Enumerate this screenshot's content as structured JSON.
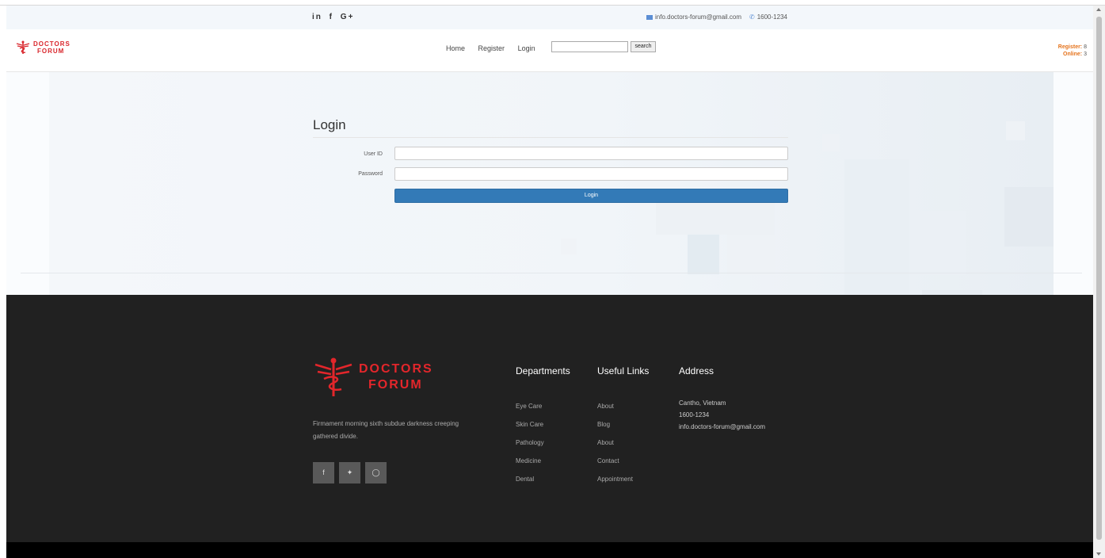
{
  "topbar": {
    "social": [
      "in",
      "f",
      "G+"
    ],
    "email": "info.doctors-forum@gmail.com",
    "phone": "1600-1234"
  },
  "brand": {
    "line1": "DOCTORS",
    "line2": "FORUM",
    "color": "#d9252b"
  },
  "nav": {
    "items": [
      "Home",
      "Register",
      "Login"
    ],
    "search_placeholder": "",
    "search_button": "search"
  },
  "stats": {
    "register_label": "Register:",
    "register_value": "8",
    "online_label": "Online:",
    "online_value": "3",
    "color": "#e5731c"
  },
  "login": {
    "title": "Login",
    "user_label": "User ID",
    "user_value": "",
    "password_label": "Password",
    "password_value": "",
    "button": "Login",
    "button_color": "#337ab7"
  },
  "footer": {
    "tagline": "Firmament morning sixth subdue darkness creeping gathered divide.",
    "social_icons": [
      "facebook-icon",
      "twitter-icon",
      "instagram-icon"
    ],
    "departments_title": "Departments",
    "departments": [
      "Eye Care",
      "Skin Care",
      "Pathology",
      "Medicine",
      "Dental"
    ],
    "useful_title": "Useful Links",
    "useful": [
      "About",
      "Blog",
      "About",
      "Contact",
      "Appointment"
    ],
    "address_title": "Address",
    "address": [
      "Cantho, Vietnam",
      "1600-1234",
      "info.doctors-forum@gmail.com"
    ]
  }
}
